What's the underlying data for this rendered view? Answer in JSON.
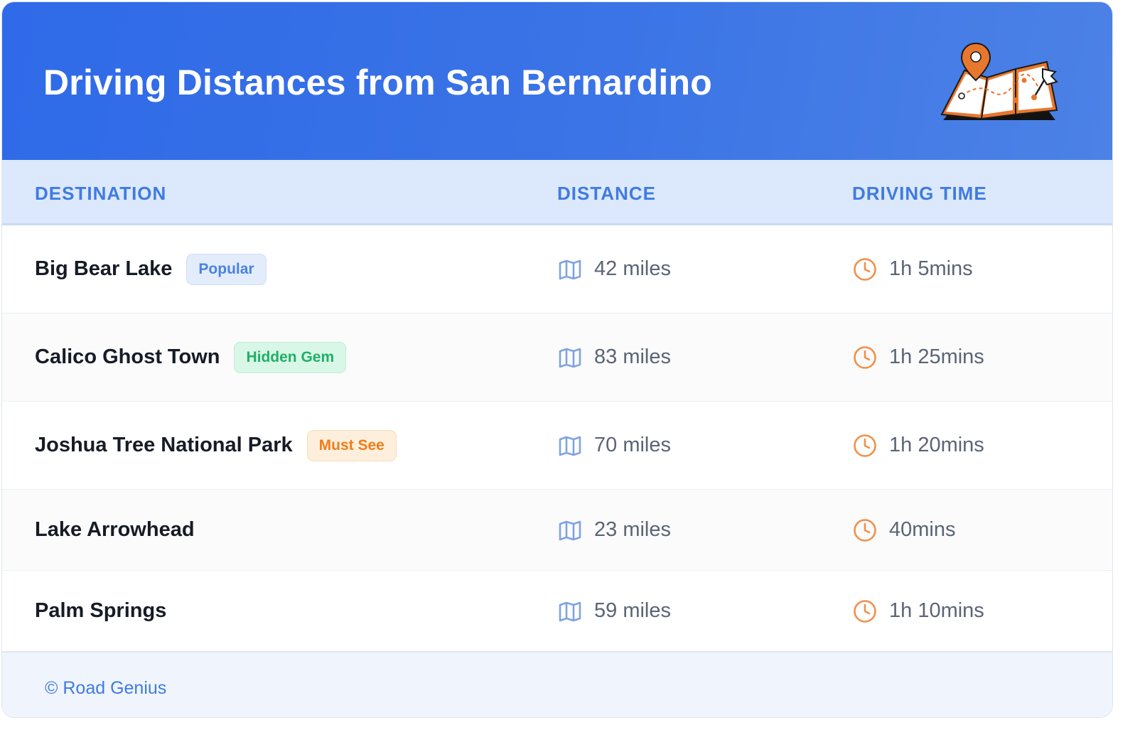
{
  "header": {
    "title": "Driving Distances from San Bernardino",
    "illustration": "folded-map-with-pins-icon"
  },
  "columns": {
    "destination": "DESTINATION",
    "distance": "DISTANCE",
    "driving_time": "DRIVING TIME"
  },
  "rows": [
    {
      "destination": "Big Bear Lake",
      "badge": "Popular",
      "badge_color": "#4a82df",
      "distance": "42 miles",
      "time": "1h 5mins"
    },
    {
      "destination": "Calico Ghost Town",
      "badge": "Hidden Gem",
      "badge_color": "#1fb066",
      "distance": "83 miles",
      "time": "1h 25mins"
    },
    {
      "destination": "Joshua Tree National Park",
      "badge": "Must See",
      "badge_color": "#ef7d1c",
      "distance": "70 miles",
      "time": "1h 20mins"
    },
    {
      "destination": "Lake Arrowhead",
      "badge": null,
      "distance": "23 miles",
      "time": "40mins"
    },
    {
      "destination": "Palm Springs",
      "badge": null,
      "distance": "59 miles",
      "time": "1h 10mins"
    }
  ],
  "icons": {
    "distance": "map-icon",
    "time": "clock-icon"
  },
  "colors": {
    "header_gradient_start": "#2f6ae8",
    "header_gradient_end": "#4c82e6",
    "accent_blue": "#3f7be0",
    "clock_orange": "#f0904a",
    "map_icon_blue": "#7fa3e0"
  },
  "footer": {
    "text": "© Road Genius"
  }
}
